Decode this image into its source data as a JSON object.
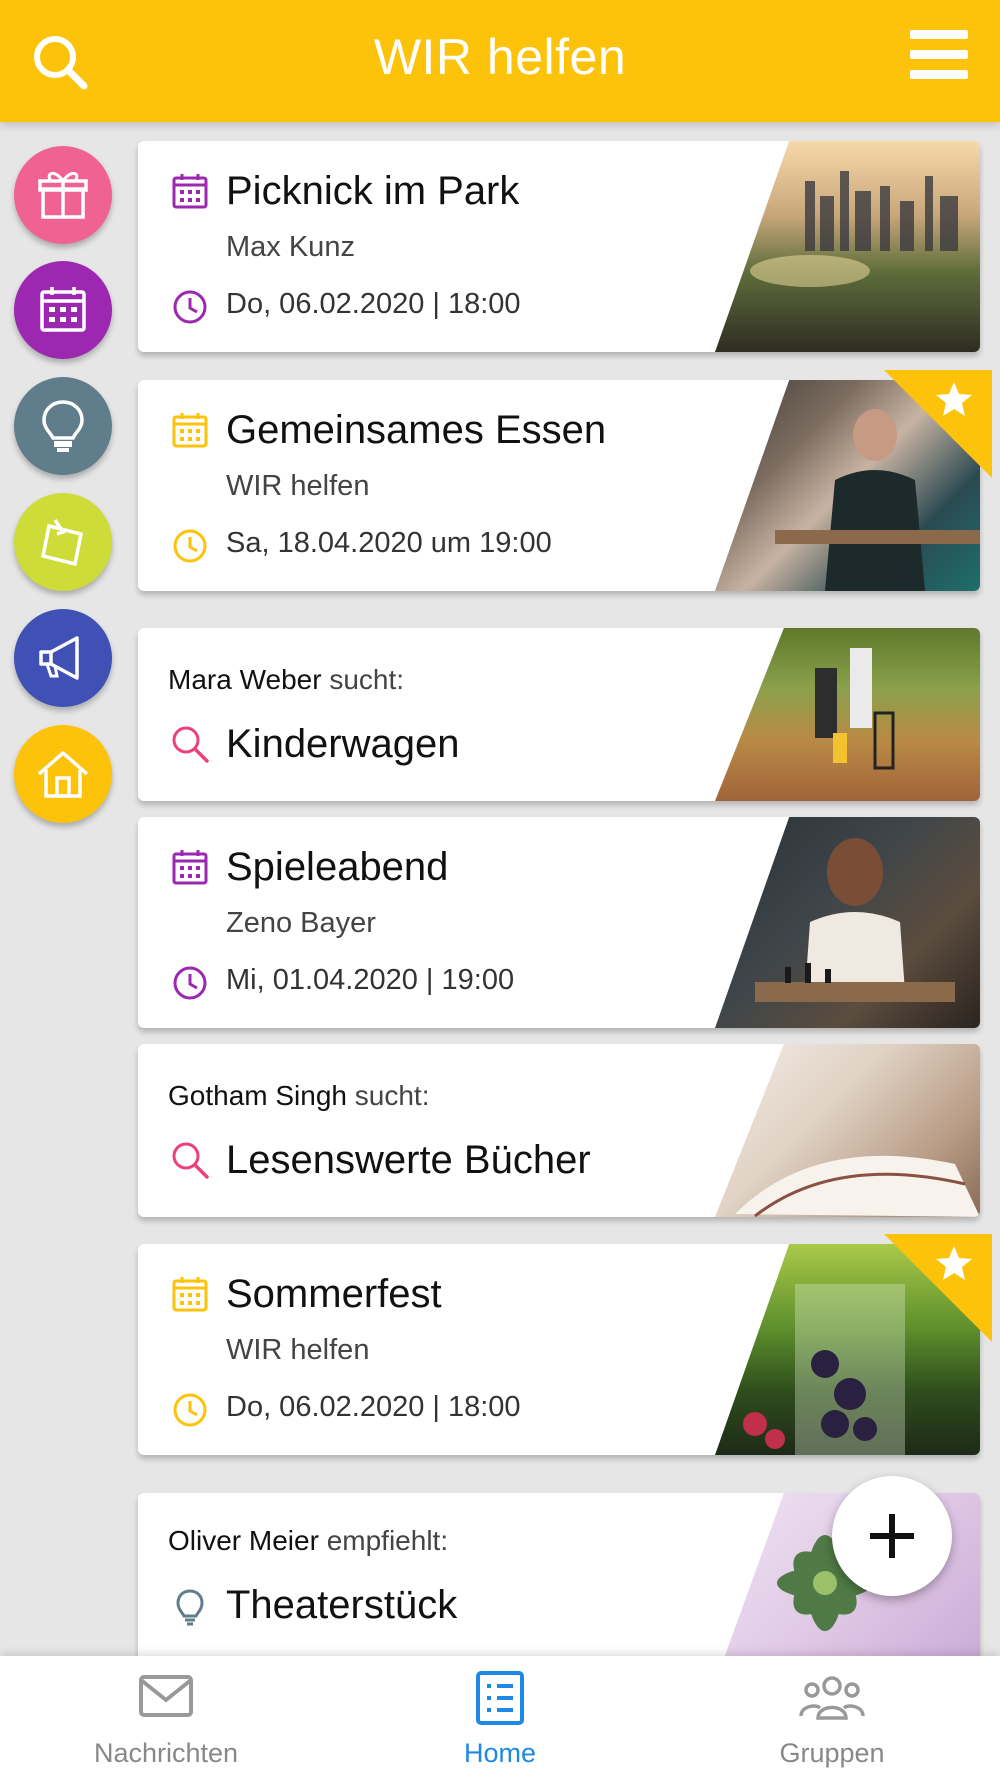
{
  "app": {
    "title": "WIR helfen"
  },
  "colors": {
    "accent": "#fdc20a",
    "purple": "#9c27b0",
    "pink": "#ec407a",
    "blue_active": "#1e88e5"
  },
  "sidebar": {
    "categories": [
      {
        "name": "gift-icon",
        "color": "#f06292"
      },
      {
        "name": "calendar-icon",
        "color": "#9c27b0"
      },
      {
        "name": "lightbulb-icon",
        "color": "#607d8b"
      },
      {
        "name": "note-icon",
        "color": "#cddc39"
      },
      {
        "name": "megaphone-icon",
        "color": "#3f51b5"
      },
      {
        "name": "home-icon",
        "color": "#fdc20a"
      }
    ]
  },
  "feed": {
    "items": [
      {
        "type": "event",
        "title": "Picknick im Park",
        "host": "Max Kunz",
        "date": "Do, 06.02.2020 | 18:00",
        "icon_color": "#9c27b0",
        "starred": false
      },
      {
        "type": "event",
        "title": "Gemeinsames Essen",
        "host": "WIR helfen",
        "date": "Sa, 18.04.2020 um 19:00",
        "icon_color": "#fdc20a",
        "starred": true
      },
      {
        "type": "search",
        "person": "Mara Weber",
        "verb": "sucht:",
        "title": "Kinderwagen"
      },
      {
        "type": "event",
        "title": "Spieleabend",
        "host": "Zeno Bayer",
        "date": "Mi, 01.04.2020 | 19:00",
        "icon_color": "#9c27b0",
        "starred": false
      },
      {
        "type": "search",
        "person": "Gotham Singh",
        "verb": "sucht:",
        "title": "Lesenswerte Bücher"
      },
      {
        "type": "event",
        "title": "Sommerfest",
        "host": "WIR helfen",
        "date": "Do, 06.02.2020 | 18:00",
        "icon_color": "#fdc20a",
        "starred": true
      },
      {
        "type": "recommend",
        "person": "Oliver Meier",
        "verb": "empfiehlt:",
        "title": "Theaterstück"
      }
    ]
  },
  "bottom_nav": {
    "items": [
      {
        "label": "Nachrichten",
        "icon": "mail-icon",
        "active": false
      },
      {
        "label": "Home",
        "icon": "list-icon",
        "active": true
      },
      {
        "label": "Gruppen",
        "icon": "group-icon",
        "active": false
      }
    ]
  }
}
